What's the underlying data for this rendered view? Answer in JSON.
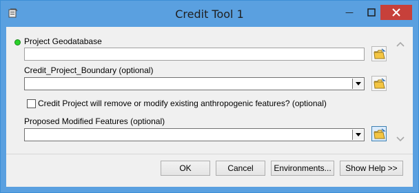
{
  "window": {
    "title": "Credit Tool 1"
  },
  "params": {
    "project_gdb_label": "Project Geodatabase",
    "project_gdb_value": "",
    "boundary_label": "Credit_Project_Boundary (optional)",
    "boundary_value": "",
    "anthro_checkbox_label": "Credit Project will remove or modify existing anthropogenic features? (optional)",
    "anthro_checked": false,
    "modified_label": "Proposed Modified Features (optional)",
    "modified_value": ""
  },
  "buttons": {
    "ok": "OK",
    "cancel": "Cancel",
    "environments": "Environments...",
    "show_help": "Show Help >>"
  },
  "colors": {
    "title_bar": "#5aa0e0",
    "close": "#c7403a",
    "required_dot": "#2bd12b"
  }
}
